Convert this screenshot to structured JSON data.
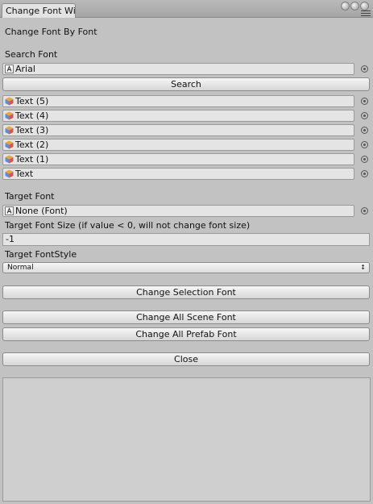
{
  "window": {
    "tab_title": "Change Font Wi"
  },
  "header": {
    "title": "Change Font By Font"
  },
  "search_font": {
    "label": "Search Font",
    "value": "Arial",
    "icon": "font-asset-icon",
    "button": "Search"
  },
  "results": {
    "icon": "gameobject-cube-icon",
    "items": [
      "Text (5)",
      "Text (4)",
      "Text (3)",
      "Text (2)",
      "Text (1)",
      "Text"
    ]
  },
  "target_font": {
    "label": "Target Font",
    "value": "None (Font)",
    "icon": "font-asset-icon"
  },
  "target_font_size": {
    "label": "Target Font Size (if value < 0, will not change font size)",
    "value": "-1"
  },
  "target_font_style": {
    "label": "Target FontStyle",
    "selected": "Normal"
  },
  "actions": {
    "change_selection": "Change Selection Font",
    "change_all_scene": "Change All Scene Font",
    "change_all_prefab": "Change All Prefab Font",
    "close": "Close"
  }
}
